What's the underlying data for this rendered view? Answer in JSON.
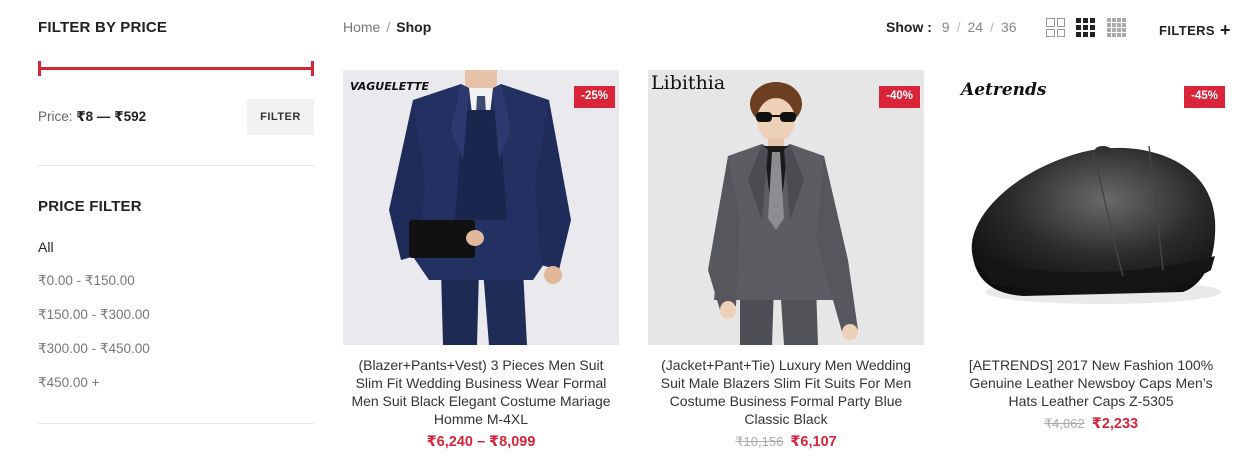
{
  "sidebar": {
    "filter_by_price": {
      "title": "FILTER BY PRICE",
      "price_label": "Price:",
      "range_text": "₹8 — ₹592",
      "filter_button": "FILTER"
    },
    "price_filter": {
      "title": "PRICE FILTER",
      "items": [
        {
          "label": "All",
          "active": true
        },
        {
          "label": "₹0.00 - ₹150.00"
        },
        {
          "label": "₹150.00 - ₹300.00"
        },
        {
          "label": "₹300.00 - ₹450.00"
        },
        {
          "label": "₹450.00 +"
        }
      ]
    }
  },
  "breadcrumb": {
    "home": "Home",
    "separator": "/",
    "current": "Shop"
  },
  "toolbar": {
    "show_label": "Show :",
    "show_options": [
      "9",
      "24",
      "36"
    ],
    "show_separator": "/",
    "filters_label": "FILTERS",
    "filters_icon": "+",
    "grid_views": [
      "grid-2-icon",
      "grid-3-icon",
      "grid-4-icon"
    ],
    "active_grid_view": "grid-3-icon"
  },
  "products": [
    {
      "brand": "VAGUELETTE",
      "discount": "-25%",
      "title": "(Blazer+Pants+Vest) 3 Pieces Men Suit Slim Fit Wedding Business Wear Formal Men Suit Black Elegant Costume Mariage Homme M-4XL",
      "old_price": "",
      "price": "₹6,240 – ₹8,099",
      "image_bg": "#e9e9ee"
    },
    {
      "brand": "Libithia",
      "discount": "-40%",
      "title": "(Jacket+Pant+Tie) Luxury Men Wedding Suit Male Blazers Slim Fit Suits For Men Costume Business Formal Party Blue Classic Black",
      "old_price": "₹10,156",
      "price": "₹6,107",
      "image_bg": "#e6e6e6"
    },
    {
      "brand": "Aetrends",
      "discount": "-45%",
      "title": "[AETRENDS] 2017 New Fashion 100% Genuine Leather Newsboy Caps Men’s Hats Leather Caps Z-5305",
      "old_price": "₹4,062",
      "price": "₹2,233",
      "image_bg": "#ffffff"
    }
  ],
  "colors": {
    "accent": "#d9243a",
    "text": "#222222",
    "muted": "#777777"
  }
}
